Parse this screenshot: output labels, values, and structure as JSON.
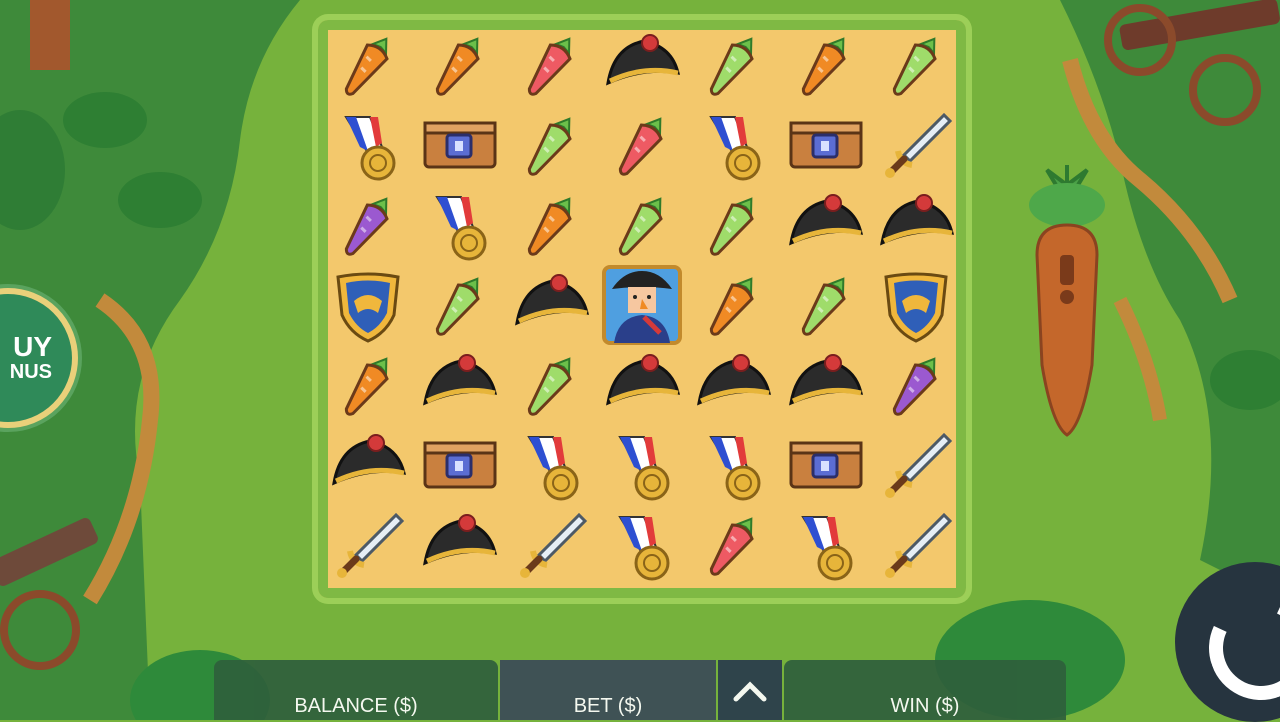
{
  "buy_bonus": {
    "line1": "UY",
    "line2": "NUS"
  },
  "bottom_bar": {
    "balance_label": "BALANCE ($)",
    "bet_label": "BET ($)",
    "win_label": "WIN ($)"
  },
  "colors": {
    "carrot_orange": "#f08a24",
    "carrot_pink": "#ee5a63",
    "carrot_green": "#9fdc6a",
    "carrot_purple": "#9b59d0",
    "hat_black": "#2b2b2b",
    "gold": "#e7b53a",
    "board_sand": "#f3c86c"
  },
  "grid": {
    "rows": [
      [
        "carrot-orange",
        "carrot-orange",
        "carrot-pink",
        "bicorne-hat",
        "carrot-green",
        "carrot-orange",
        "carrot-green"
      ],
      [
        "medal",
        "treasure-chest",
        "carrot-green",
        "carrot-pink",
        "medal",
        "treasure-chest",
        "sword"
      ],
      [
        "carrot-purple",
        "medal",
        "carrot-orange",
        "carrot-green",
        "carrot-green",
        "bicorne-hat",
        "bicorne-hat"
      ],
      [
        "shield",
        "carrot-green",
        "bicorne-hat",
        "napoleon",
        "carrot-orange",
        "carrot-green",
        "shield"
      ],
      [
        "carrot-orange",
        "bicorne-hat",
        "carrot-green",
        "bicorne-hat",
        "bicorne-hat",
        "bicorne-hat",
        "carrot-purple"
      ],
      [
        "bicorne-hat",
        "treasure-chest",
        "medal",
        "medal",
        "medal",
        "treasure-chest",
        "sword"
      ],
      [
        "sword",
        "bicorne-hat",
        "sword",
        "medal",
        "carrot-pink",
        "medal",
        "sword"
      ]
    ]
  }
}
